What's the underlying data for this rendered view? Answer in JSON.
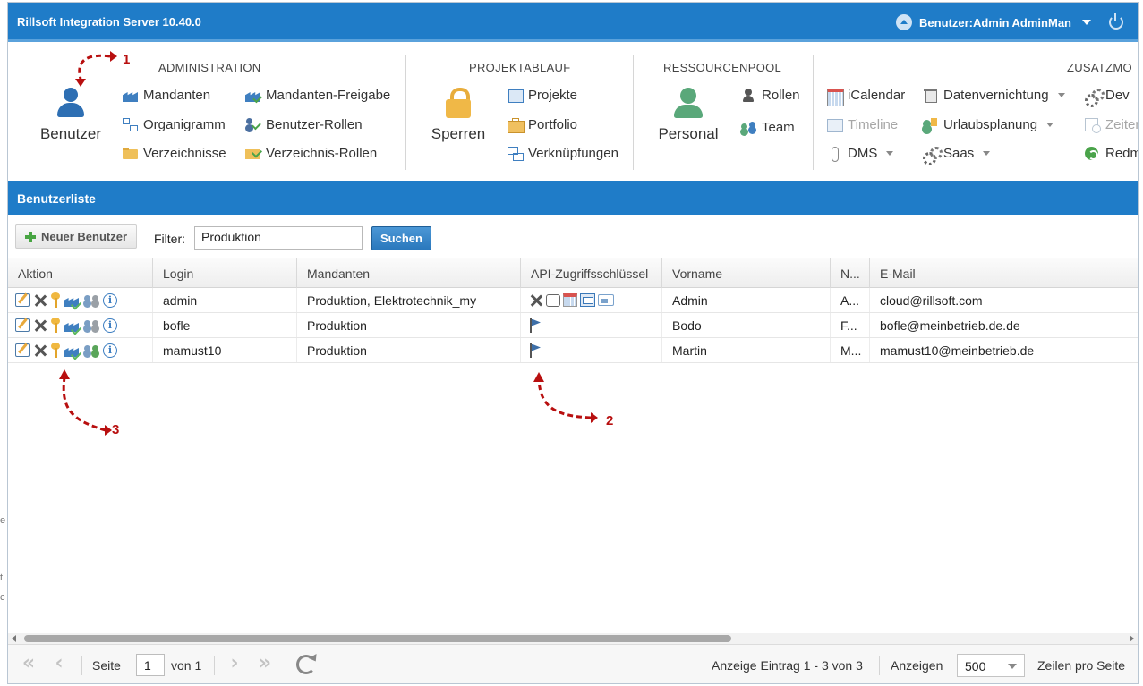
{
  "app": {
    "title": "Rillsoft Integration Server 10.40.0",
    "user_label": "Benutzer:Admin AdminMan"
  },
  "ribbon": {
    "administration": {
      "title": "ADMINISTRATION",
      "big_button": "Benutzer",
      "items": [
        "Mandanten",
        "Organigramm",
        "Verzeichnisse",
        "Mandanten-Freigabe",
        "Benutzer-Rollen",
        "Verzeichnis-Rollen"
      ]
    },
    "projektablauf": {
      "title": "PROJEKTABLAUF",
      "big_button": "Sperren",
      "items": [
        "Projekte",
        "Portfolio",
        "Verknüpfungen"
      ]
    },
    "ressourcenpool": {
      "title": "RESSOURCENPOOL",
      "big_button": "Personal",
      "items": [
        "Rollen",
        "Team"
      ]
    },
    "zusatzmodule": {
      "title": "ZUSATZMO",
      "items": [
        "iCalendar",
        "Timeline",
        "DMS",
        "Datenvernichtung",
        "Urlaubsplanung",
        "Saas",
        "Dev",
        "Zeiten",
        "Redm"
      ]
    }
  },
  "section": {
    "title": "Benutzerliste"
  },
  "toolbar": {
    "new_user": "Neuer Benutzer",
    "filter_label": "Filter:",
    "filter_value": "Produktion",
    "search": "Suchen"
  },
  "grid": {
    "columns": [
      "Aktion",
      "Login",
      "Mandanten",
      "API-Zugriffsschlüssel",
      "Vorname",
      "N...",
      "E-Mail"
    ],
    "rows": [
      {
        "login": "admin",
        "mandanten": "Produktion, Elektrotechnik_my",
        "vorname": "Admin",
        "n": "A...",
        "email": "cloud@rillsoft.com"
      },
      {
        "login": "bofle",
        "mandanten": "Produktion",
        "vorname": "Bodo",
        "n": "F...",
        "email": "bofle@meinbetrieb.de.de"
      },
      {
        "login": "mamust10",
        "mandanten": "Produktion",
        "vorname": "Martin",
        "n": "M...",
        "email": "mamust10@meinbetrieb.de"
      }
    ]
  },
  "pager": {
    "page_label": "Seite",
    "page_value": "1",
    "of_label": "von 1",
    "info": "Anzeige Eintrag 1 - 3 von 3",
    "show_label": "Anzeigen",
    "page_size": "500",
    "rows_label": "Zeilen pro Seite"
  },
  "annotations": [
    "1",
    "2",
    "3"
  ],
  "colors": {
    "primary": "#1f7cc8",
    "annotation": "#b80f0f"
  }
}
